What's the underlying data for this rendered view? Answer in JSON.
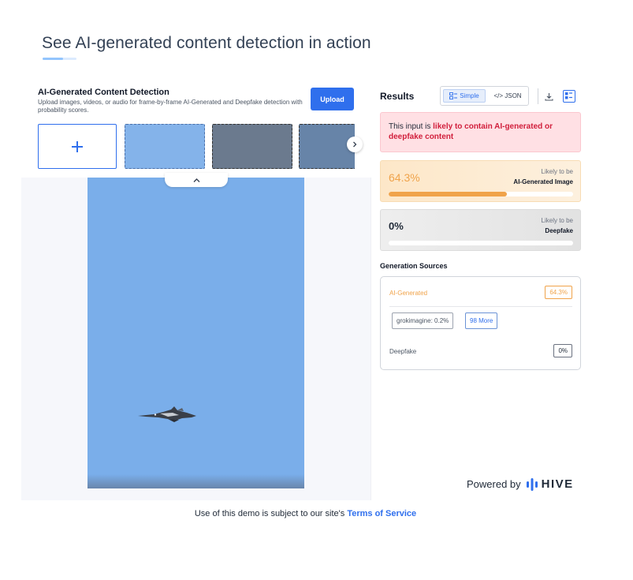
{
  "page": {
    "heading": "See AI-generated content detection in action"
  },
  "upload": {
    "title": "AI-Generated Content Detection",
    "description": "Upload images, videos, or audio for frame-by-frame AI-Generated and Deepfake detection with probability scores.",
    "upload_label": "Upload",
    "add_icon": "plus-icon",
    "next_icon": "chevron-right-icon",
    "collapse_icon": "chevron-up-icon"
  },
  "results": {
    "title": "Results",
    "toggle_simple": "Simple",
    "toggle_json": "</> JSON",
    "alert_prefix": "This input is ",
    "alert_highlight": "likely to contain AI-generated or deepfake content",
    "ai_score": {
      "value": "64.3%",
      "fraction": 0.643,
      "label_line1": "Likely to be",
      "label_line2": "AI-Generated Image"
    },
    "deepfake_score": {
      "value": "0%",
      "fraction": 0.0,
      "label_line1": "Likely to be",
      "label_line2": "Deepfake"
    }
  },
  "sources": {
    "title": "Generation Sources",
    "ai_label": "AI-Generated",
    "ai_value": "64.3%",
    "chips": [
      "grokimagine: 0.2%",
      "98 More"
    ],
    "deepfake_label": "Deepfake",
    "deepfake_value": "0%"
  },
  "branding": {
    "powered_by": "Powered by",
    "logo_text": "HIVE"
  },
  "footer": {
    "text": "Use of this demo is subject to our site's ",
    "link": "Terms of Service"
  },
  "colors": {
    "accent": "#2f6fed",
    "ai_orange": "#f0a34a",
    "alert_red": "#d11f3c"
  }
}
